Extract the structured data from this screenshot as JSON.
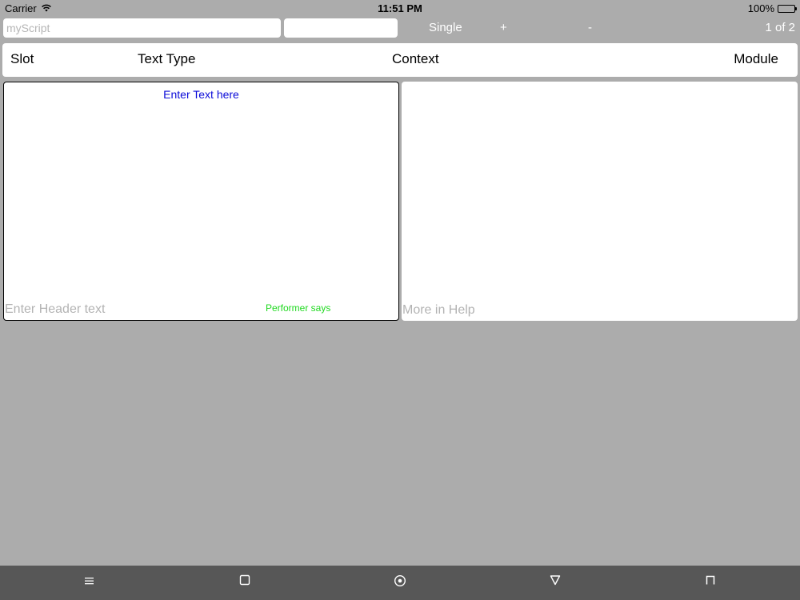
{
  "status_bar": {
    "carrier": "Carrier",
    "time": "11:51 PM",
    "battery": "100%"
  },
  "toolbar": {
    "script_input_placeholder": "myScript",
    "second_input_value": "",
    "mode_label": "Single",
    "plus_label": "+",
    "minus_label": "-",
    "page_counter": "1 of 2"
  },
  "header_row": {
    "slot": "Slot",
    "text_type": "Text Type",
    "context": "Context",
    "module": "Module"
  },
  "left_panel": {
    "title": "Enter Text here",
    "header_placeholder": "Enter Header text",
    "performer_says": "Performer says"
  },
  "right_panel": {
    "help_placeholder": "More in Help"
  },
  "nav_bar": {
    "icons": [
      "menu-icon",
      "square-icon",
      "circle-dot-icon",
      "triangle-down-icon",
      "tab-icon"
    ]
  },
  "colors": {
    "background": "#acacac",
    "panel": "#ffffff",
    "title_blue": "#0b0bd8",
    "performer_green": "#1ed81e",
    "nav_bar": "#575757"
  }
}
